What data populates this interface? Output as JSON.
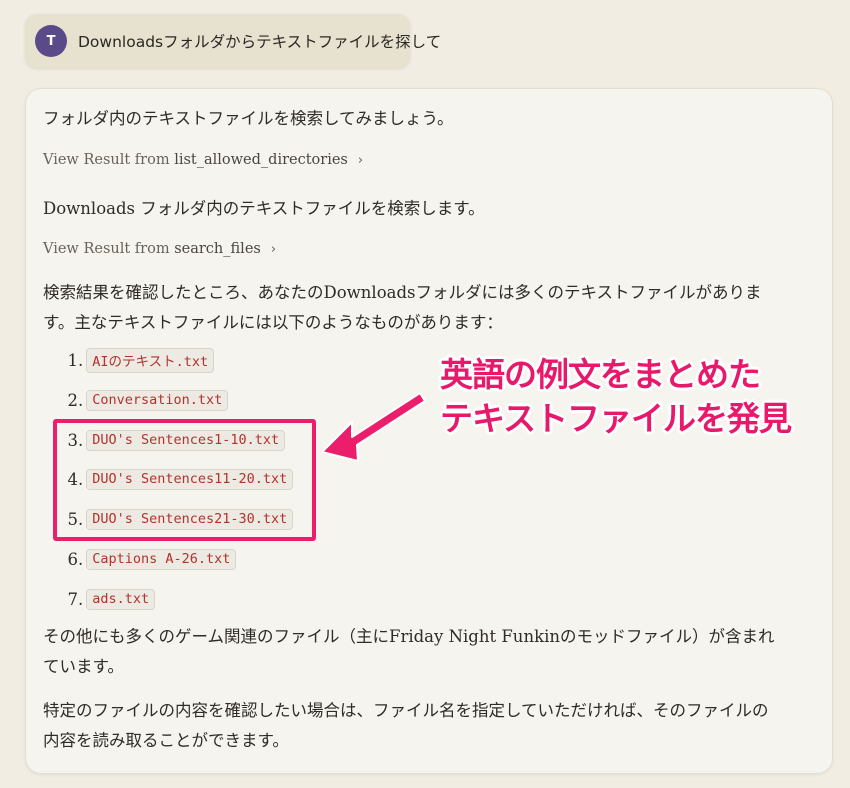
{
  "user_message": {
    "avatar_initial": "T",
    "text": "Downloadsフォルダからテキストファイルを探して"
  },
  "response": {
    "intro": "フォルダ内のテキストファイルを検索してみましょう。",
    "tool_call_1": {
      "prefix": "View Result from ",
      "tool": "list_allowed_directories"
    },
    "mid_text": "Downloads フォルダ内のテキストファイルを検索します。",
    "tool_call_2": {
      "prefix": "View Result from ",
      "tool": "search_files"
    },
    "result_para": "検索結果を確認したところ、あなたのDownloadsフォルダには多くのテキストファイルがあります。主なテキストファイルには以下のようなものがあります：",
    "files": [
      {
        "num": "1",
        "name": "AIのテキスト.txt"
      },
      {
        "num": "2",
        "name": "Conversation.txt"
      },
      {
        "num": "3",
        "name": "DUO's Sentences1-10.txt"
      },
      {
        "num": "4",
        "name": "DUO's Sentences11-20.txt"
      },
      {
        "num": "5",
        "name": "DUO's Sentences21-30.txt"
      },
      {
        "num": "6",
        "name": "Captions A-26.txt"
      },
      {
        "num": "7",
        "name": "ads.txt"
      }
    ],
    "other_para": "その他にも多くのゲーム関連のファイル（主にFriday Night Funkinのモッドファイル）が含まれています。",
    "closing_para": "特定のファイルの内容を確認したい場合は、ファイル名を指定していただければ、そのファイルの内容を読み取ることができます。"
  },
  "annotation": {
    "line1": "英語の例文をまとめた",
    "line2": "テキストファイルを発見",
    "color": "#e8186a"
  },
  "icons": {
    "chevron": "chevron-right-icon"
  }
}
